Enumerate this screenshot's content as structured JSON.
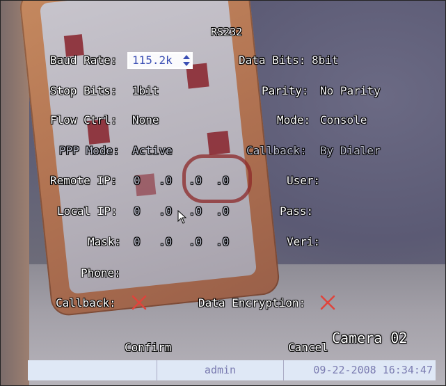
{
  "window": {
    "title": "RS232"
  },
  "form": {
    "baud_rate": {
      "label": "Baud Rate:",
      "value": "115.2k"
    },
    "data_bits": {
      "label": "Data Bits:",
      "value": "8bit"
    },
    "stop_bits": {
      "label": "Stop Bits:",
      "value": "1bit"
    },
    "parity": {
      "label": "Parity:",
      "value": "No Parity"
    },
    "flow_ctrl": {
      "label": "Flow Ctrl:",
      "value": "None"
    },
    "mode": {
      "label": "Mode:",
      "value": "Console"
    },
    "ppp_mode": {
      "label": "PPP Mode:",
      "value": "Active"
    },
    "callback_type": {
      "label": "Callback:",
      "value": "By Dialer"
    },
    "remote_ip": {
      "label": "Remote IP:",
      "octets": [
        "0",
        ".0",
        ".0",
        ".0"
      ]
    },
    "local_ip": {
      "label": "Local IP:",
      "octets": [
        "0",
        ".0",
        ".0",
        ".0"
      ]
    },
    "mask": {
      "label": "Mask:",
      "octets": [
        "0",
        ".0",
        ".0",
        ".0"
      ]
    },
    "user": {
      "label": "User:",
      "value": ""
    },
    "pass": {
      "label": "Pass:",
      "value": ""
    },
    "veri": {
      "label": "Veri:",
      "value": ""
    },
    "phone": {
      "label": "Phone:",
      "value": ""
    },
    "callback_check": {
      "label": "Callback:",
      "checked": false,
      "icon": "x-mark-icon"
    },
    "data_encryption": {
      "label": "Data Encryption:",
      "checked": false,
      "icon": "x-mark-icon"
    }
  },
  "buttons": {
    "confirm": "Confirm",
    "cancel": "Cancel"
  },
  "overlay": {
    "camera": "Camera 02"
  },
  "status_bar": {
    "segment1": "",
    "user": "admin",
    "datetime": "09-22-2008 16:34:47"
  },
  "colors": {
    "osd_text": "#ffffff",
    "dim_text": "#b9bccb",
    "x_mark": "#e0443c",
    "status_text": "#7a7bb0",
    "selected_text": "#3a4eb4"
  }
}
